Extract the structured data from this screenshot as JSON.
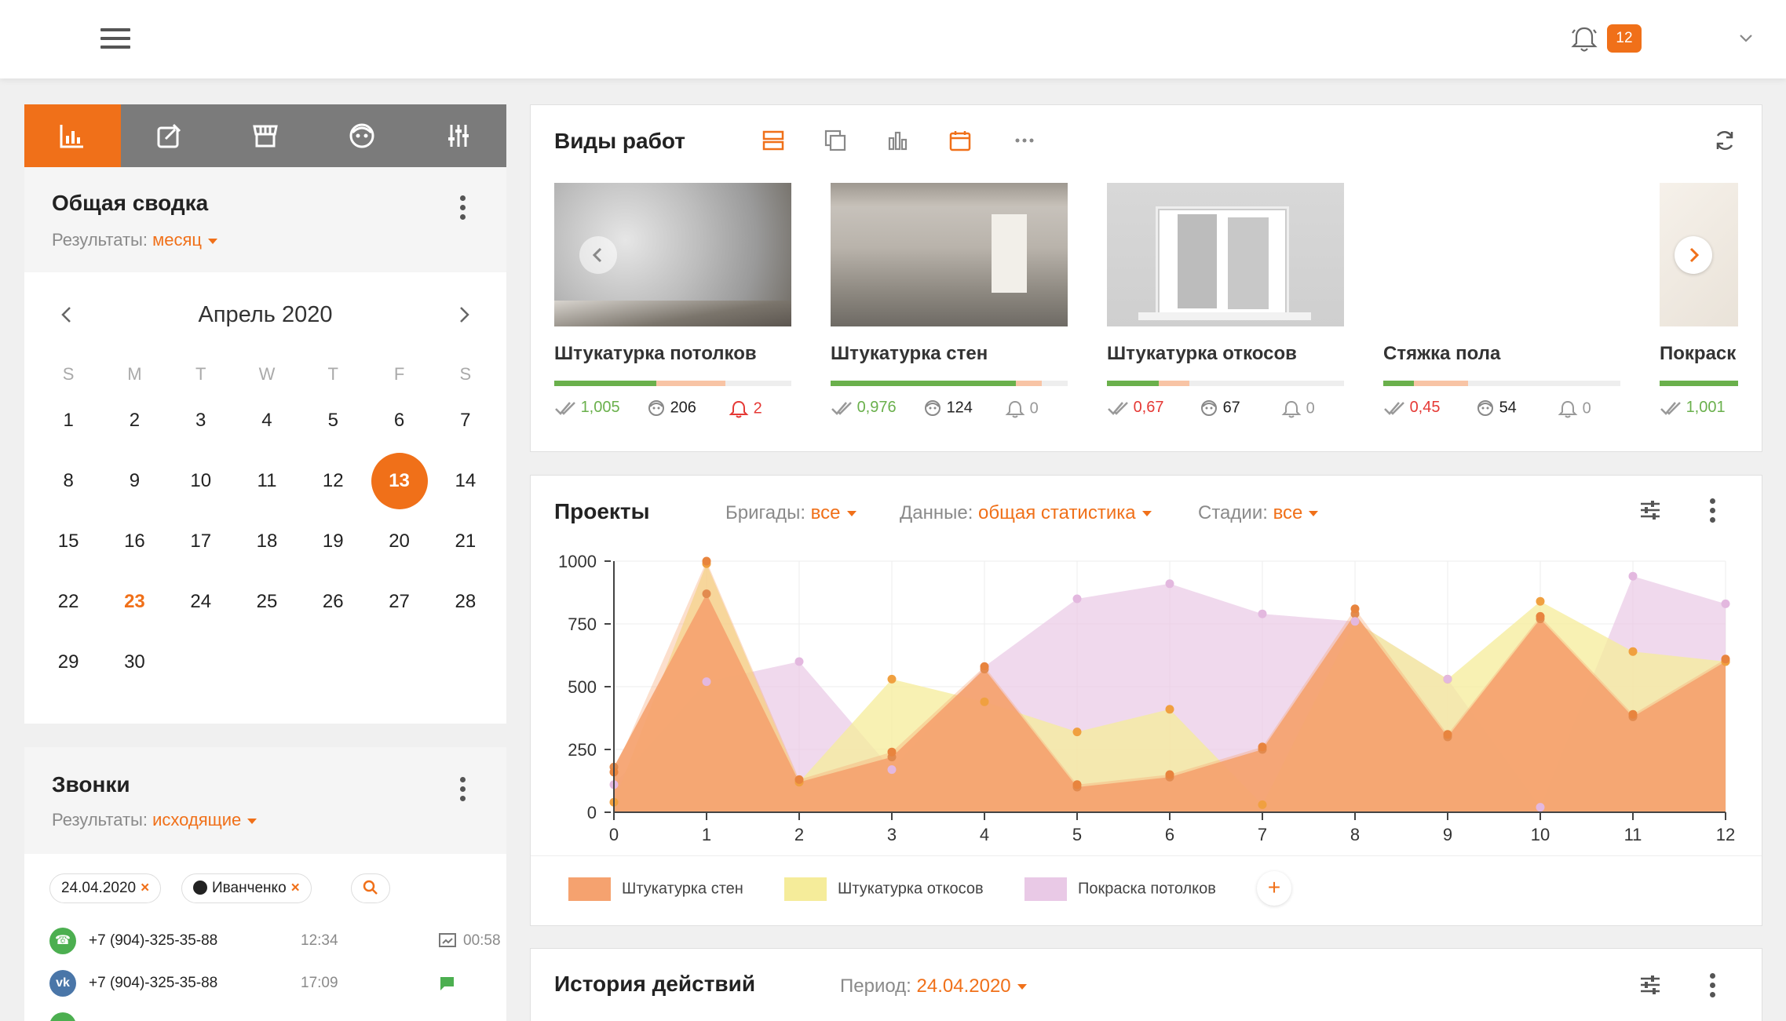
{
  "topbar": {
    "notifications_count": "12"
  },
  "left_tabs": [
    "stats-icon",
    "edit-icon",
    "store-icon",
    "face-icon",
    "sliders-icon"
  ],
  "summary": {
    "title": "Общая сводка",
    "results_label": "Результаты:",
    "results_value": "месяц"
  },
  "calendar": {
    "month": "Апрель 2020",
    "weekdays": [
      "S",
      "M",
      "T",
      "W",
      "T",
      "F",
      "S"
    ],
    "weeks": [
      [
        "1",
        "2",
        "3",
        "4",
        "5",
        "6",
        "7"
      ],
      [
        "8",
        "9",
        "10",
        "11",
        "12",
        "13",
        "14"
      ],
      [
        "15",
        "16",
        "17",
        "18",
        "19",
        "20",
        "21"
      ],
      [
        "22",
        "23",
        "24",
        "25",
        "26",
        "27",
        "28"
      ],
      [
        "29",
        "30",
        "",
        "",
        "",
        "",
        ""
      ]
    ],
    "today": "13",
    "marked": "23"
  },
  "calls": {
    "title": "Звонки",
    "results_label": "Результаты:",
    "results_value": "исходящие",
    "chip_date": "24.04.2020",
    "chip_person": "Иванченко",
    "rows": [
      {
        "phone": "+7 (904)-325-35-88",
        "time": "12:34",
        "duration": "00:58",
        "source": "phone",
        "badge": "☎"
      },
      {
        "phone": "+7 (904)-325-35-88",
        "time": "17:09",
        "duration": "",
        "source": "vk",
        "badge": "vk"
      }
    ]
  },
  "works": {
    "title": "Виды работ",
    "items": [
      {
        "name": "Штукатурка потолков",
        "done": "1,005",
        "done_color": "#6ab04c",
        "count": "206",
        "alerts": "2",
        "alerts_color": "#e53935",
        "green": 0.43,
        "orange": 0.29
      },
      {
        "name": "Штукатурка стен",
        "done": "0,976",
        "done_color": "#6ab04c",
        "count": "124",
        "alerts": "0",
        "alerts_color": "#999",
        "green": 0.78,
        "orange": 0.11
      },
      {
        "name": "Штукатурка откосов",
        "done": "0,67",
        "done_color": "#e53935",
        "count": "67",
        "alerts": "0",
        "alerts_color": "#999",
        "green": 0.22,
        "orange": 0.13
      },
      {
        "name": "Стяжка пола",
        "done": "0,45",
        "done_color": "#e53935",
        "count": "54",
        "alerts": "0",
        "alerts_color": "#999",
        "green": 0.13,
        "orange": 0.23
      },
      {
        "name": "Покраск",
        "done": "1,001",
        "done_color": "#6ab04c",
        "count": "",
        "alerts": "",
        "alerts_color": "#999",
        "green": 1.0,
        "orange": 0.0
      }
    ]
  },
  "projects": {
    "title": "Проекты",
    "filters": [
      {
        "label": "Бригады:",
        "value": "все"
      },
      {
        "label": "Данные:",
        "value": "общая статистика"
      },
      {
        "label": "Стадии:",
        "value": "все"
      }
    ]
  },
  "chart_data": {
    "type": "area",
    "x": [
      0,
      1,
      2,
      3,
      4,
      5,
      6,
      7,
      8,
      9,
      10,
      11,
      12
    ],
    "ylim": [
      0,
      1000
    ],
    "yticks": [
      0,
      250,
      500,
      750,
      1000
    ],
    "series": [
      {
        "name": "Штукатурка стен",
        "color": "#f5a26f",
        "values": [
          180,
          870,
          120,
          220,
          570,
          100,
          140,
          250,
          790,
          300,
          770,
          380,
          600
        ]
      },
      {
        "name": "Штукатурка откосов",
        "color": "#f5ec9a",
        "values": [
          40,
          990,
          120,
          530,
          440,
          320,
          410,
          30,
          760,
          530,
          840,
          640,
          600
        ]
      },
      {
        "name": "Покраска потолков",
        "color": "#e9c9e6",
        "values": [
          110,
          520,
          600,
          170,
          580,
          850,
          910,
          790,
          760,
          530,
          20,
          940,
          830
        ]
      },
      {
        "name": "",
        "color": "#f07019",
        "values": [
          160,
          1000,
          130,
          240,
          580,
          110,
          150,
          260,
          810,
          310,
          780,
          390,
          610
        ]
      }
    ],
    "grid": true
  },
  "history": {
    "title": "История действий",
    "period_label": "Период:",
    "period_value": "24.04.2020"
  }
}
